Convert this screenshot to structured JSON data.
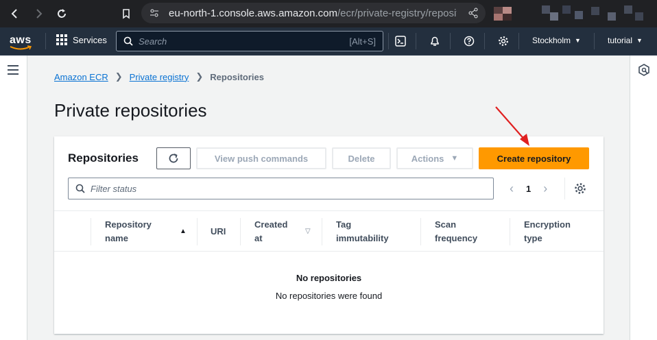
{
  "browser": {
    "url_host": "eu-north-1.console.aws.amazon.com",
    "url_path": "/ecr/private-registry/reposit..."
  },
  "aws_nav": {
    "logo": "aws",
    "services_label": "Services",
    "search_placeholder": "Search",
    "search_shortcut": "[Alt+S]",
    "region": "Stockholm",
    "account": "tutorial"
  },
  "breadcrumb": {
    "items": [
      "Amazon ECR",
      "Private registry",
      "Repositories"
    ]
  },
  "page": {
    "title": "Private repositories"
  },
  "panel": {
    "title": "Repositories",
    "view_push_label": "View push commands",
    "delete_label": "Delete",
    "actions_label": "Actions",
    "create_label": "Create repository",
    "filter_placeholder": "Filter status",
    "page_number": "1"
  },
  "table": {
    "columns": [
      {
        "line1": "Repository",
        "line2": "name"
      },
      {
        "line1": "URI",
        "line2": ""
      },
      {
        "line1": "Created",
        "line2": "at"
      },
      {
        "line1": "Tag",
        "line2": "immutability"
      },
      {
        "line1": "Scan",
        "line2": "frequency"
      },
      {
        "line1": "Encryption",
        "line2": "type"
      }
    ],
    "empty_title": "No repositories",
    "empty_message": "No repositories were found"
  },
  "colors": {
    "accent": "#ff9900",
    "link": "#0972d3",
    "nav_bg": "#232f3e",
    "annotation_arrow": "#e02020"
  }
}
